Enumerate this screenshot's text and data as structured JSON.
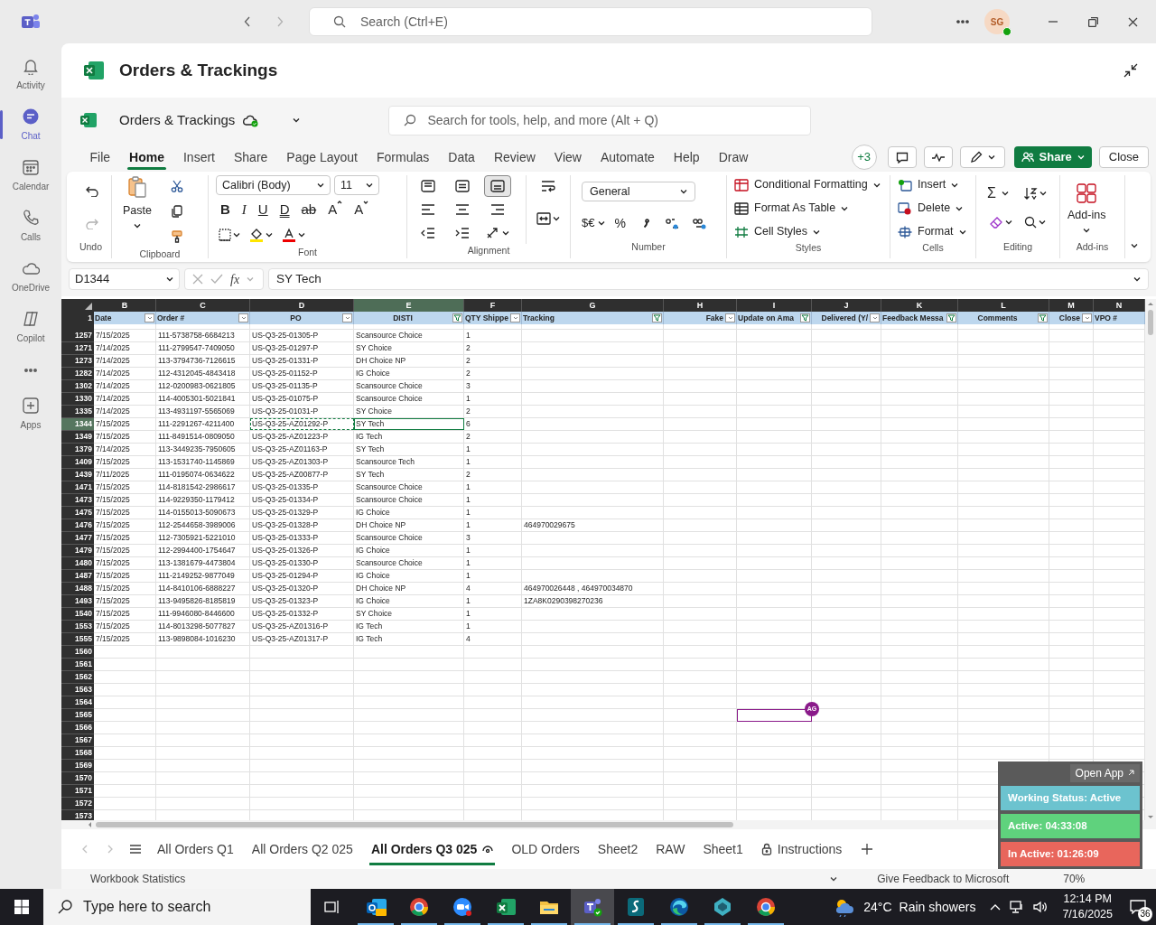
{
  "teams": {
    "search_placeholder": "Search (Ctrl+E)",
    "avatar": "SG",
    "rail": [
      {
        "label": "Activity",
        "kind": "activity",
        "selected": false
      },
      {
        "label": "Chat",
        "kind": "chat",
        "selected": true
      },
      {
        "label": "Calendar",
        "kind": "calendar",
        "selected": false
      },
      {
        "label": "Calls",
        "kind": "calls",
        "selected": false
      },
      {
        "label": "OneDrive",
        "kind": "onedrive",
        "selected": false
      },
      {
        "label": "Copilot",
        "kind": "copilot",
        "selected": false
      },
      {
        "kind": "more",
        "selected": false
      },
      {
        "label": "Apps",
        "kind": "apps",
        "selected": false
      }
    ]
  },
  "app": {
    "title": "Orders & Trackings"
  },
  "excel": {
    "file_name": "Orders & Trackings",
    "search_placeholder": "Search for tools, help, and more (Alt + Q)",
    "menu": [
      {
        "label": "File",
        "selected": false
      },
      {
        "label": "Home",
        "selected": true
      },
      {
        "label": "Insert",
        "selected": false
      },
      {
        "label": "Share",
        "selected": false
      },
      {
        "label": "Page Layout",
        "selected": false
      },
      {
        "label": "Formulas",
        "selected": false
      },
      {
        "label": "Data",
        "selected": false
      },
      {
        "label": "Review",
        "selected": false
      },
      {
        "label": "View",
        "selected": false
      },
      {
        "label": "Automate",
        "selected": false
      },
      {
        "label": "Help",
        "selected": false
      },
      {
        "label": "Draw",
        "selected": false
      }
    ],
    "collaborators": "+3",
    "share": "Share",
    "close": "Close"
  },
  "ribbon": {
    "undo_label": "Undo",
    "clipboard": {
      "paste": "Paste",
      "label": "Clipboard"
    },
    "font": {
      "name": "Calibri (Body)",
      "size": "11",
      "buttons": [
        "B",
        "I",
        "U",
        "D",
        "ab",
        "A",
        "A"
      ],
      "label": "Font"
    },
    "alignment": {
      "label": "Alignment"
    },
    "number": {
      "format": "General",
      "currency": "$€",
      "percent": "%",
      "label": "Number"
    },
    "styles": {
      "items": [
        "Conditional Formatting",
        "Format As Table",
        "Cell Styles"
      ],
      "label": "Styles"
    },
    "cells": {
      "items": [
        "Insert",
        "Delete",
        "Format"
      ],
      "label": "Cells"
    },
    "editing": {
      "sum": "Σ",
      "label": "Editing"
    },
    "addins": {
      "button": "Add-ins",
      "label": "Add-ins"
    }
  },
  "formula_bar": {
    "name_box": "D1344",
    "fx": "fx",
    "value": "SY Tech"
  },
  "sheet": {
    "corner_row": "1",
    "columns": [
      {
        "letter": "B",
        "header": "Date",
        "kind": "dropdown",
        "selected": false
      },
      {
        "letter": "C",
        "header": "Order #",
        "kind": "dropdown",
        "selected": false
      },
      {
        "letter": "D",
        "header": "PO",
        "kind": "dropdown",
        "selected": false
      },
      {
        "letter": "E",
        "header": "DISTI",
        "kind": "filtered",
        "selected": true
      },
      {
        "letter": "F",
        "header": "QTY Shippe",
        "kind": "dropdown",
        "selected": false
      },
      {
        "letter": "G",
        "header": "Tracking",
        "kind": "filtered",
        "selected": false
      },
      {
        "letter": "H",
        "header": "Fake",
        "kind": "dropdown",
        "selected": false
      },
      {
        "letter": "I",
        "header": "Update on Ama",
        "kind": "filtered",
        "selected": false,
        "presence": true
      },
      {
        "letter": "J",
        "header": "Delivered (Y/",
        "kind": "dropdown",
        "selected": false
      },
      {
        "letter": "K",
        "header": "Feedback Messa",
        "kind": "filtered",
        "selected": false
      },
      {
        "letter": "L",
        "header": "Comments",
        "kind": "filtered",
        "selected": false
      },
      {
        "letter": "M",
        "header": "Close",
        "kind": "dropdown",
        "selected": false
      },
      {
        "letter": "N",
        "header": "VPO #",
        "kind": "plain",
        "selected": false
      }
    ],
    "rows": [
      {
        "n": "1257",
        "selected": false,
        "cells": [
          "7/15/2025",
          "111-5738758-6684213",
          "US-Q3-25-01305-P",
          "Scansource Choice",
          "1"
        ]
      },
      {
        "n": "1271",
        "selected": false,
        "cells": [
          "7/14/2025",
          "111-2799547-7409050",
          "US-Q3-25-01297-P",
          "SY Choice",
          "2"
        ]
      },
      {
        "n": "1273",
        "selected": false,
        "cells": [
          "7/14/2025",
          "113-3794736-7126615",
          "US-Q3-25-01331-P",
          "DH Choice NP",
          "2"
        ]
      },
      {
        "n": "1282",
        "selected": false,
        "cells": [
          "7/14/2025",
          "112-4312045-4843418",
          "US-Q3-25-01152-P",
          "IG Choice",
          "2"
        ]
      },
      {
        "n": "1302",
        "selected": false,
        "cells": [
          "7/14/2025",
          "112-0200983-0621805",
          "US-Q3-25-01135-P",
          "Scansource Choice",
          "3"
        ]
      },
      {
        "n": "1330",
        "selected": false,
        "cells": [
          "7/14/2025",
          "114-4005301-5021841",
          "US-Q3-25-01075-P",
          "Scansource Choice",
          "1"
        ]
      },
      {
        "n": "1335",
        "selected": false,
        "cells": [
          "7/14/2025",
          "113-4931197-5565069",
          "US-Q3-25-01031-P",
          "SY Choice",
          "2"
        ]
      },
      {
        "n": "1344",
        "selected": true,
        "cells": [
          {
            "text": "7/15/2025",
            "active": false,
            "copied": false
          },
          {
            "text": "111-2291267-4211400",
            "active": false,
            "copied": false
          },
          {
            "text": "US-Q3-25-AZ01292-P",
            "active": false,
            "copied": true
          },
          {
            "text": "SY Tech",
            "active": true,
            "copied": false
          },
          {
            "text": "6",
            "active": false,
            "copied": false
          }
        ]
      },
      {
        "n": "1349",
        "selected": false,
        "cells": [
          "7/15/2025",
          "111-8491514-0809050",
          "US-Q3-25-AZ01223-P",
          "IG Tech",
          "2"
        ]
      },
      {
        "n": "1379",
        "selected": false,
        "cells": [
          "7/14/2025",
          "113-3449235-7950605",
          "US-Q3-25-AZ01163-P",
          "SY Tech",
          "1"
        ]
      },
      {
        "n": "1409",
        "selected": false,
        "cells": [
          "7/15/2025",
          "113-1531740-1145869",
          "US-Q3-25-AZ01303-P",
          "Scansource Tech",
          "1"
        ]
      },
      {
        "n": "1439",
        "selected": false,
        "cells": [
          "7/11/2025",
          "111-0195074-0634622",
          "US-Q3-25-AZ00877-P",
          "SY Tech",
          "2"
        ]
      },
      {
        "n": "1471",
        "selected": false,
        "cells": [
          "7/15/2025",
          "114-8181542-2986617",
          "US-Q3-25-01335-P",
          "Scansource Choice",
          "1"
        ]
      },
      {
        "n": "1473",
        "selected": false,
        "cells": [
          "7/15/2025",
          "114-9229350-1179412",
          "US-Q3-25-01334-P",
          "Scansource Choice",
          "1"
        ]
      },
      {
        "n": "1475",
        "selected": false,
        "cells": [
          "7/15/2025",
          "114-0155013-5090673",
          "US-Q3-25-01329-P",
          "IG Choice",
          "1"
        ]
      },
      {
        "n": "1476",
        "selected": false,
        "cells": [
          "7/15/2025",
          "112-2544658-3989006",
          "US-Q3-25-01328-P",
          "DH Choice NP",
          "1",
          "464970029675"
        ]
      },
      {
        "n": "1477",
        "selected": false,
        "cells": [
          "7/15/2025",
          "112-7305921-5221010",
          "US-Q3-25-01333-P",
          "Scansource Choice",
          "3"
        ]
      },
      {
        "n": "1479",
        "selected": false,
        "cells": [
          "7/15/2025",
          "112-2994400-1754647",
          "US-Q3-25-01326-P",
          "IG Choice",
          "1"
        ]
      },
      {
        "n": "1480",
        "selected": false,
        "cells": [
          "7/15/2025",
          "113-1381679-4473804",
          "US-Q3-25-01330-P",
          "Scansource Choice",
          "1"
        ]
      },
      {
        "n": "1487",
        "selected": false,
        "cells": [
          "7/15/2025",
          "111-2149252-9877049",
          "US-Q3-25-01294-P",
          "IG Choice",
          "1"
        ]
      },
      {
        "n": "1488",
        "selected": false,
        "cells": [
          "7/15/2025",
          "114-8410106-6888227",
          "US-Q3-25-01320-P",
          "DH Choice NP",
          "4",
          "464970026448 , 464970034870"
        ]
      },
      {
        "n": "1493",
        "selected": false,
        "cells": [
          "7/15/2025",
          "113-9495826-8185819",
          "US-Q3-25-01323-P",
          "IG Choice",
          "1",
          "1ZA8K0290398270236"
        ]
      },
      {
        "n": "1540",
        "selected": false,
        "cells": [
          "7/15/2025",
          "111-9946080-8446600",
          "US-Q3-25-01332-P",
          "SY Choice",
          "1"
        ]
      },
      {
        "n": "1553",
        "selected": false,
        "cells": [
          "7/15/2025",
          "114-8013298-5077827",
          "US-Q3-25-AZ01316-P",
          "IG Tech",
          "1"
        ]
      },
      {
        "n": "1555",
        "selected": false,
        "cells": [
          "7/15/2025",
          "113-9898084-1016230",
          "US-Q3-25-AZ01317-P",
          "IG Tech",
          "4"
        ]
      },
      {
        "n": "1560",
        "selected": false
      },
      {
        "n": "1561",
        "selected": false
      },
      {
        "n": "1562",
        "selected": false
      },
      {
        "n": "1563",
        "selected": false
      },
      {
        "n": "1564",
        "selected": false
      },
      {
        "n": "1565",
        "selected": false,
        "presence": {
          "initials": "AG"
        }
      },
      {
        "n": "1566",
        "selected": false
      },
      {
        "n": "1567",
        "selected": false
      },
      {
        "n": "1568",
        "selected": false
      },
      {
        "n": "1569",
        "selected": false
      },
      {
        "n": "1570",
        "selected": false
      },
      {
        "n": "1571",
        "selected": false
      },
      {
        "n": "1572",
        "selected": false
      },
      {
        "n": "1573",
        "selected": false
      }
    ]
  },
  "sheet_tabs": [
    {
      "label": "All Orders Q1",
      "kind": "plain",
      "selected": false
    },
    {
      "label": "All Orders Q2 025",
      "kind": "plain",
      "selected": false
    },
    {
      "label": "All Orders Q3 025",
      "kind": "viewed",
      "selected": true
    },
    {
      "label": "OLD Orders",
      "kind": "plain",
      "selected": false
    },
    {
      "label": "Sheet2",
      "kind": "plain",
      "selected": false
    },
    {
      "label": "RAW",
      "kind": "plain",
      "selected": false
    },
    {
      "label": "Sheet1",
      "kind": "plain",
      "selected": false
    },
    {
      "label": "Instructions",
      "kind": "protected",
      "selected": false
    }
  ],
  "status_bar": {
    "left": "Workbook Statistics",
    "feedback": "Give Feedback to Microsoft",
    "zoom": "70%"
  },
  "widget": {
    "open_app": "Open App",
    "statuses": [
      {
        "label": "Working Status: Active",
        "color": "#6cc3cf"
      },
      {
        "label": "Active: 04:33:08",
        "color": "#5fd27d"
      },
      {
        "label": "In Active: 01:26:09",
        "color": "#e8665c"
      }
    ]
  },
  "taskbar": {
    "search_placeholder": "Type here to search",
    "apps": [
      {
        "kind": "outlook",
        "selected": false
      },
      {
        "kind": "chrome",
        "selected": false
      },
      {
        "kind": "zoom",
        "selected": false
      },
      {
        "kind": "excel",
        "selected": false
      },
      {
        "kind": "explorer",
        "selected": false
      },
      {
        "kind": "teams",
        "selected": true
      },
      {
        "kind": "sway",
        "selected": false
      },
      {
        "kind": "edge",
        "selected": false
      },
      {
        "kind": "diamond",
        "selected": false
      },
      {
        "kind": "chrome",
        "selected": false
      }
    ],
    "temperature": "24°C",
    "weather": "Rain showers",
    "time": "12:14 PM",
    "date": "7/16/2025",
    "notifications": "36"
  }
}
